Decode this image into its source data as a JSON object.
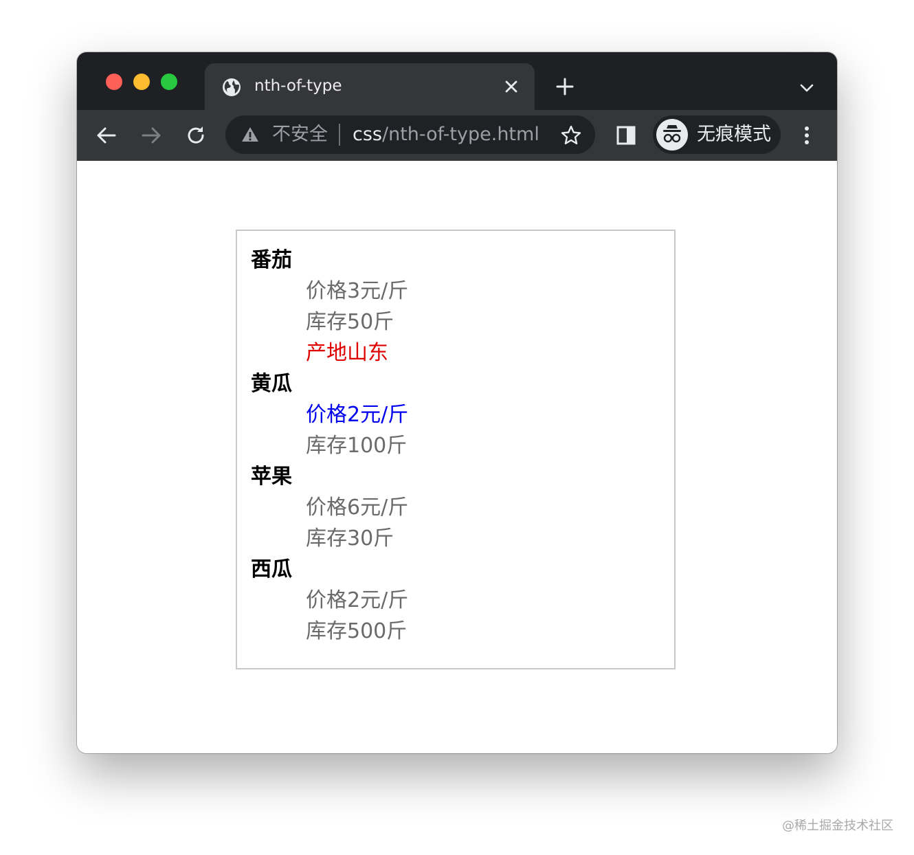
{
  "browser": {
    "tab": {
      "title": "nth-of-type",
      "icon": "globe-icon"
    },
    "omnibox": {
      "security_label": "不安全",
      "url_host": "css",
      "url_path": "/nth-of-type.html"
    },
    "incognito": {
      "label": "无痕模式"
    }
  },
  "page": {
    "items": [
      {
        "name": "番茄",
        "props": [
          {
            "text": "价格3元/斤",
            "color": "#6a6a6a"
          },
          {
            "text": "库存50斤",
            "color": "#6a6a6a"
          },
          {
            "text": "产地山东",
            "color": "#e00000"
          }
        ]
      },
      {
        "name": "黄瓜",
        "props": [
          {
            "text": "价格2元/斤",
            "color": "#0000ee"
          },
          {
            "text": "库存100斤",
            "color": "#6a6a6a"
          }
        ]
      },
      {
        "name": "苹果",
        "props": [
          {
            "text": "价格6元/斤",
            "color": "#6a6a6a"
          },
          {
            "text": "库存30斤",
            "color": "#6a6a6a"
          }
        ]
      },
      {
        "name": "西瓜",
        "props": [
          {
            "text": "价格2元/斤",
            "color": "#6a6a6a"
          },
          {
            "text": "库存500斤",
            "color": "#6a6a6a"
          }
        ]
      }
    ]
  },
  "watermark": "@稀土掘金技术社区"
}
